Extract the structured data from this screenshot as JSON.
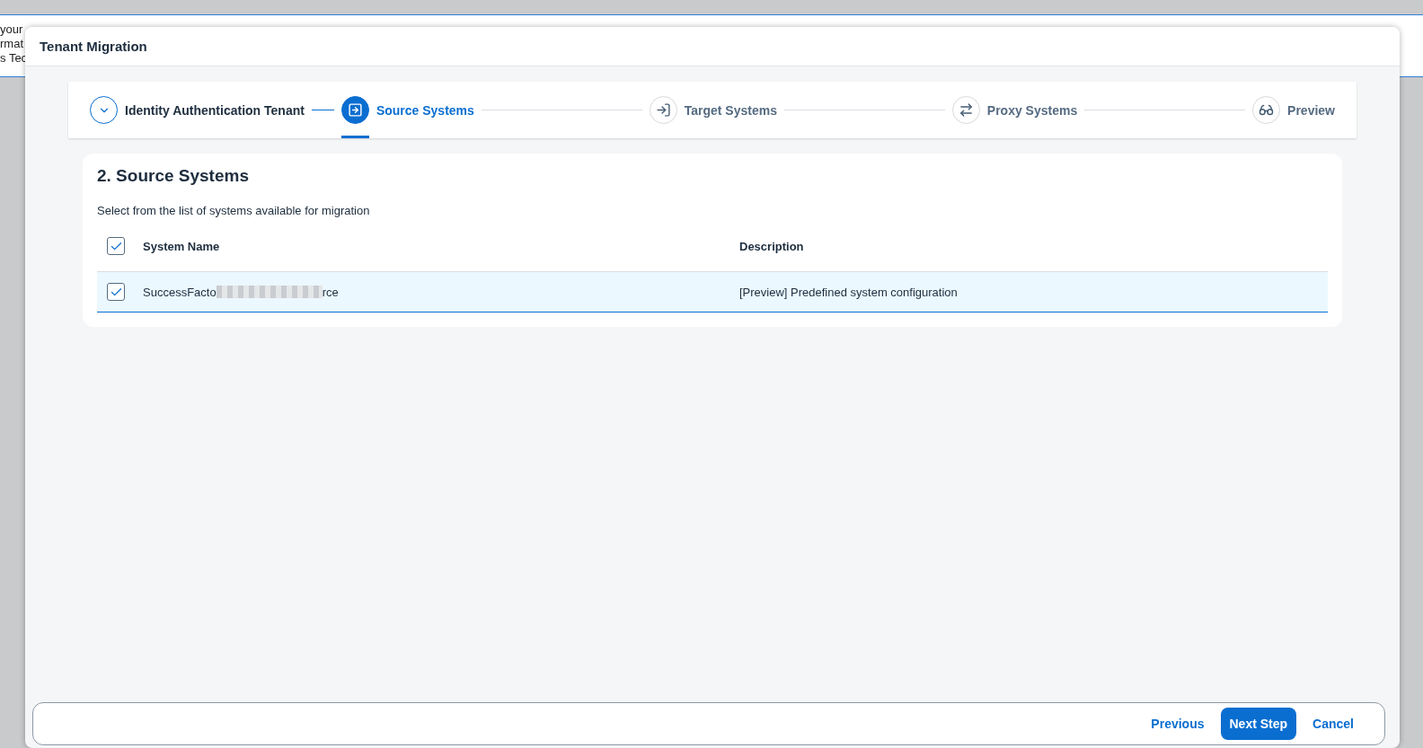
{
  "background": {
    "fragments": [
      "your",
      "rmat",
      "s Tec"
    ]
  },
  "dialog": {
    "title": "Tenant Migration"
  },
  "steps": [
    {
      "label": "Identity Authentication Tenant",
      "completed": true,
      "selected": false
    },
    {
      "label": "Source Systems",
      "completed": false,
      "selected": true
    },
    {
      "label": "Target Systems",
      "completed": false,
      "selected": false
    },
    {
      "label": "Proxy Systems",
      "completed": false,
      "selected": false
    },
    {
      "label": "Preview",
      "completed": false,
      "selected": false
    }
  ],
  "section": {
    "title": "2. Source Systems",
    "description": "Select from the list of systems available for migration"
  },
  "table": {
    "select_all_checked": true,
    "columns": [
      "System Name",
      "Description"
    ],
    "rows": [
      {
        "name_start": "SuccessFacto",
        "name_end": "rce",
        "description": "[Preview] Predefined system configuration",
        "checked": true,
        "selected": true
      }
    ]
  },
  "footer": {
    "buttons": [
      {
        "label": "Previous",
        "kind": "link"
      },
      {
        "label": "Next Step",
        "kind": "primary"
      },
      {
        "label": "Cancel",
        "kind": "link"
      }
    ]
  }
}
